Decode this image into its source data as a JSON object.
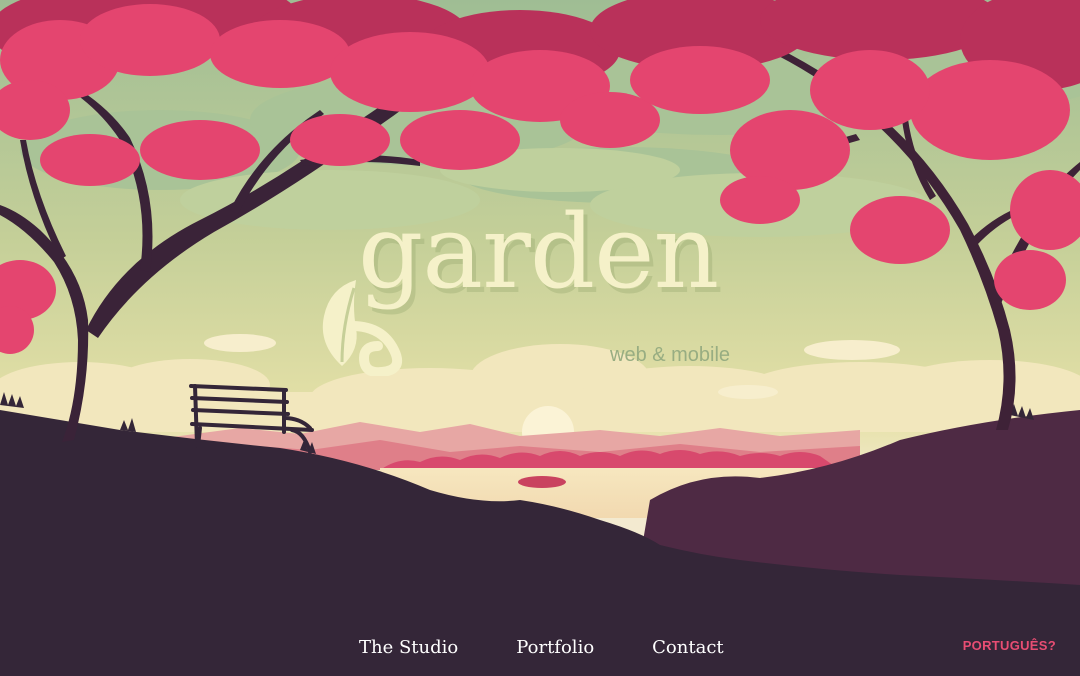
{
  "brand": {
    "name": "garden",
    "tagline": "web & mobile"
  },
  "nav": {
    "items": [
      {
        "label": "The Studio"
      },
      {
        "label": "Portfolio"
      },
      {
        "label": "Contact"
      }
    ],
    "language_label": "PORTUGUÊS?"
  },
  "colors": {
    "sky": "#c6cf98",
    "foliage": "#e4456f",
    "ground": "#342638",
    "logo": "#f5f1c9",
    "tagline": "#98ad82",
    "accent": "#e84d73"
  },
  "icons": [
    "leaf-icon"
  ]
}
